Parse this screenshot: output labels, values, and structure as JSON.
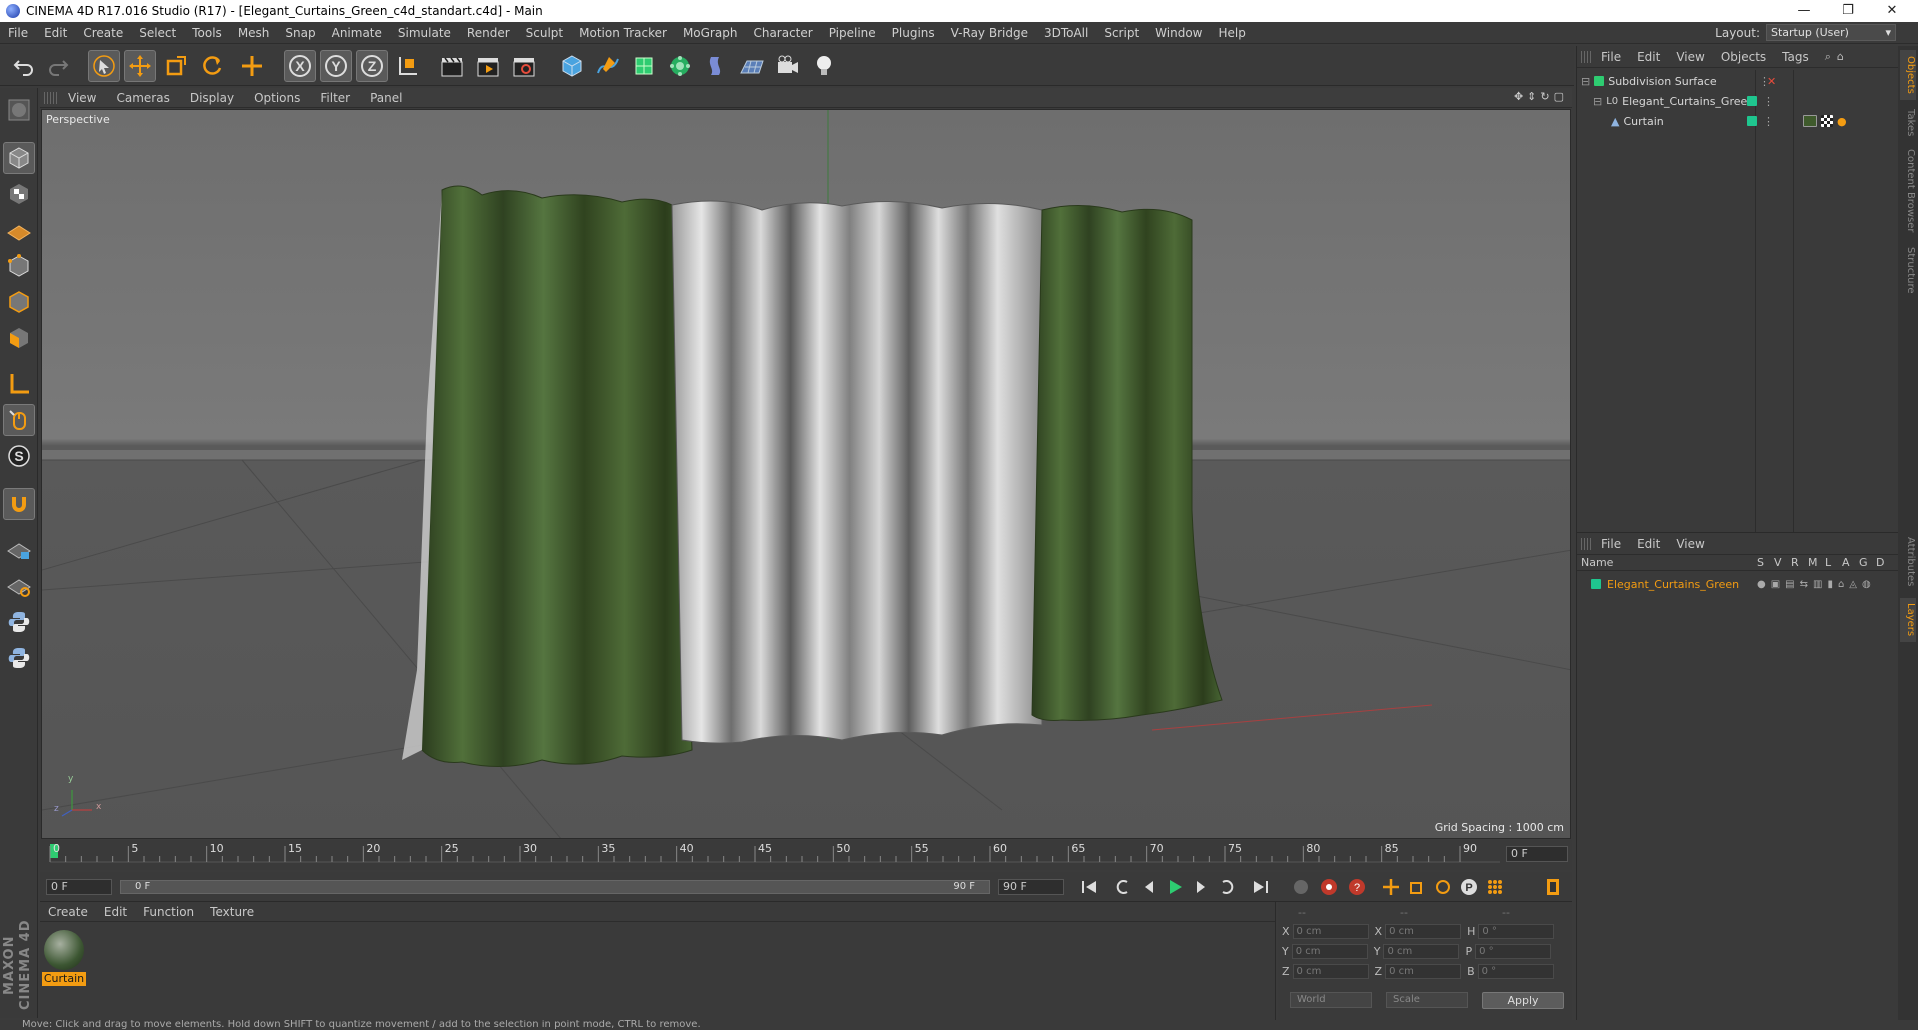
{
  "titlebar": {
    "title": "CINEMA 4D R17.016 Studio (R17) - [Elegant_Curtains_Green_c4d_standart.c4d] - Main",
    "minimize": "—",
    "restore": "❐",
    "close": "✕"
  },
  "menubar": {
    "items": [
      "File",
      "Edit",
      "Create",
      "Select",
      "Tools",
      "Mesh",
      "Snap",
      "Animate",
      "Simulate",
      "Render",
      "Sculpt",
      "Motion Tracker",
      "MoGraph",
      "Character",
      "Pipeline",
      "Plugins",
      "V-Ray Bridge",
      "3DToAll",
      "Script",
      "Window",
      "Help"
    ],
    "layout_label": "Layout:",
    "layout_value": "Startup (User)"
  },
  "viewport": {
    "menus": [
      "View",
      "Cameras",
      "Display",
      "Options",
      "Filter",
      "Panel"
    ],
    "label": "Perspective",
    "grid_spacing": "Grid Spacing : 1000 cm",
    "axis": {
      "y": "y",
      "x": "x",
      "z": "z"
    }
  },
  "timeline": {
    "ticks": [
      "0",
      "5",
      "10",
      "15",
      "20",
      "25",
      "30",
      "35",
      "40",
      "45",
      "50",
      "55",
      "60",
      "65",
      "70",
      "75",
      "80",
      "85",
      "90"
    ],
    "current_frame": "0 F",
    "start_frame": "0 F",
    "range_start": "0 F",
    "range_end": "90 F",
    "end_frame": "90 F"
  },
  "material_manager": {
    "menus": [
      "Create",
      "Edit",
      "Function",
      "Texture"
    ],
    "materials": [
      {
        "name": "Curtain"
      }
    ]
  },
  "coordinates": {
    "headers": [
      "--",
      "--",
      "--"
    ],
    "rows": [
      {
        "a_label": "X",
        "a_value": "0 cm",
        "b_label": "X",
        "b_value": "0 cm",
        "c_label": "H",
        "c_value": "0 °"
      },
      {
        "a_label": "Y",
        "a_value": "0 cm",
        "b_label": "Y",
        "b_value": "0 cm",
        "c_label": "P",
        "c_value": "0 °"
      },
      {
        "a_label": "Z",
        "a_value": "0 cm",
        "b_label": "Z",
        "b_value": "0 cm",
        "c_label": "B",
        "c_value": "0 °"
      }
    ],
    "mode_world": "World",
    "mode_scale": "Scale",
    "apply": "Apply"
  },
  "object_manager": {
    "menus": [
      "File",
      "Edit",
      "View",
      "Objects",
      "Tags"
    ],
    "objects": [
      {
        "name": "Subdivision Surface"
      },
      {
        "name": "Elegant_Curtains_Green"
      },
      {
        "name": "Curtain"
      }
    ]
  },
  "layer_manager": {
    "menus": [
      "File",
      "Edit",
      "View"
    ],
    "columns": [
      "Name",
      "S",
      "V",
      "R",
      "M",
      "L",
      "A",
      "G",
      "D"
    ],
    "layers": [
      {
        "name": "Elegant_Curtains_Green"
      }
    ]
  },
  "side_tabs": [
    "Objects",
    "Takes",
    "Content Browser",
    "Structure",
    "Attributes",
    "Layers"
  ],
  "maxon_logo": "MAXON CINEMA 4D",
  "status": "Move: Click and drag to move elements. Hold down SHIFT to quantize movement / add to the selection in point mode, CTRL to remove.",
  "colors": {
    "accent_orange": "#f39c12",
    "layer_green": "#1fc68f",
    "curtain_green": "#3f5a2c"
  }
}
